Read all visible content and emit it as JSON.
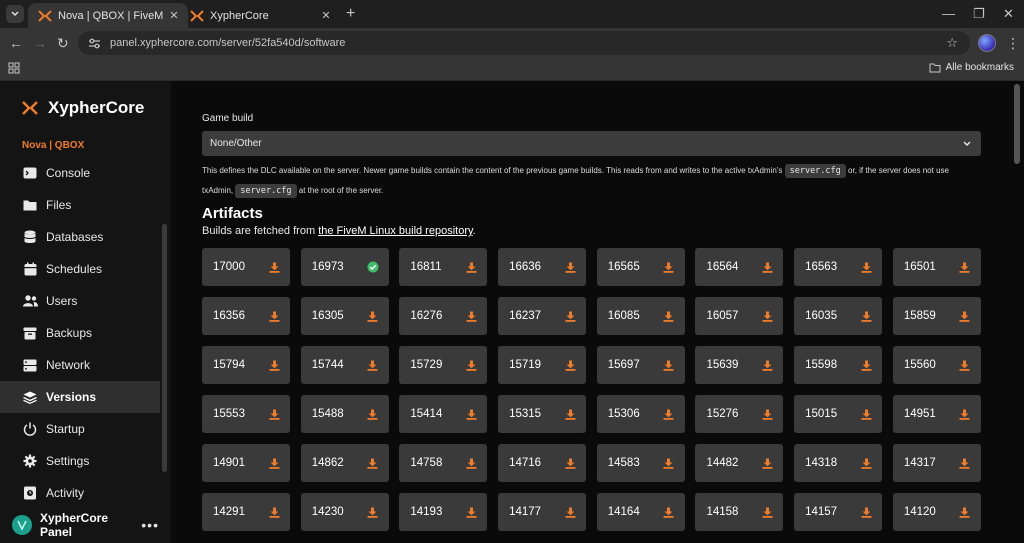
{
  "browser": {
    "tabs": [
      {
        "title": "Nova | QBOX | FiveM Software",
        "active": true
      },
      {
        "title": "XypherCore",
        "active": false
      }
    ],
    "url": "panel.xyphercore.com/server/52fa540d/software",
    "bookmarks_label": "Alle bookmarks"
  },
  "sidebar": {
    "brand": "XypherCore",
    "server_name": "Nova | QBOX",
    "items": [
      {
        "label": "Console",
        "icon": "terminal-icon"
      },
      {
        "label": "Files",
        "icon": "folder-icon"
      },
      {
        "label": "Databases",
        "icon": "database-icon"
      },
      {
        "label": "Schedules",
        "icon": "calendar-icon"
      },
      {
        "label": "Users",
        "icon": "users-icon"
      },
      {
        "label": "Backups",
        "icon": "archive-icon"
      },
      {
        "label": "Network",
        "icon": "network-icon"
      },
      {
        "label": "Versions",
        "icon": "versions-icon",
        "active": true
      },
      {
        "label": "Startup",
        "icon": "power-icon"
      },
      {
        "label": "Settings",
        "icon": "gear-icon"
      },
      {
        "label": "Activity",
        "icon": "activity-icon"
      }
    ],
    "footer_user": "XypherCore Panel"
  },
  "main": {
    "game_build_label": "Game build",
    "game_build_value": "None/Other",
    "help_text_1": "This defines the DLC available on the server. Newer game builds contain the content of the previous game builds. This reads from and writes to the active txAdmin's",
    "help_code_1": "server.cfg",
    "help_text_2": "or, if the server does not use txAdmin,",
    "help_code_2": "server.cfg",
    "help_text_3": "at the root of the server.",
    "artifacts_title": "Artifacts",
    "artifacts_sub_prefix": "Builds are fetched from",
    "artifacts_link": "the FiveM Linux build repository",
    "artifacts_sub_suffix": ".",
    "builds": [
      {
        "version": "17000",
        "installed": false
      },
      {
        "version": "16973",
        "installed": true
      },
      {
        "version": "16811",
        "installed": false
      },
      {
        "version": "16636",
        "installed": false
      },
      {
        "version": "16565",
        "installed": false
      },
      {
        "version": "16564",
        "installed": false
      },
      {
        "version": "16563",
        "installed": false
      },
      {
        "version": "16501",
        "installed": false
      },
      {
        "version": "16356",
        "installed": false
      },
      {
        "version": "16305",
        "installed": false
      },
      {
        "version": "16276",
        "installed": false
      },
      {
        "version": "16237",
        "installed": false
      },
      {
        "version": "16085",
        "installed": false
      },
      {
        "version": "16057",
        "installed": false
      },
      {
        "version": "16035",
        "installed": false
      },
      {
        "version": "15859",
        "installed": false
      },
      {
        "version": "15794",
        "installed": false
      },
      {
        "version": "15744",
        "installed": false
      },
      {
        "version": "15729",
        "installed": false
      },
      {
        "version": "15719",
        "installed": false
      },
      {
        "version": "15697",
        "installed": false
      },
      {
        "version": "15639",
        "installed": false
      },
      {
        "version": "15598",
        "installed": false
      },
      {
        "version": "15560",
        "installed": false
      },
      {
        "version": "15553",
        "installed": false
      },
      {
        "version": "15488",
        "installed": false
      },
      {
        "version": "15414",
        "installed": false
      },
      {
        "version": "15315",
        "installed": false
      },
      {
        "version": "15306",
        "installed": false
      },
      {
        "version": "15276",
        "installed": false
      },
      {
        "version": "15015",
        "installed": false
      },
      {
        "version": "14951",
        "installed": false
      },
      {
        "version": "14901",
        "installed": false
      },
      {
        "version": "14862",
        "installed": false
      },
      {
        "version": "14758",
        "installed": false
      },
      {
        "version": "14716",
        "installed": false
      },
      {
        "version": "14583",
        "installed": false
      },
      {
        "version": "14482",
        "installed": false
      },
      {
        "version": "14318",
        "installed": false
      },
      {
        "version": "14317",
        "installed": false
      },
      {
        "version": "14291",
        "installed": false
      },
      {
        "version": "14230",
        "installed": false
      },
      {
        "version": "14193",
        "installed": false
      },
      {
        "version": "14177",
        "installed": false
      },
      {
        "version": "14164",
        "installed": false
      },
      {
        "version": "14158",
        "installed": false
      },
      {
        "version": "14157",
        "installed": false
      },
      {
        "version": "14120",
        "installed": false
      }
    ]
  },
  "colors": {
    "accent": "#f07c2a",
    "installed": "#3fbf6a",
    "card_bg": "#3a3a3a"
  }
}
